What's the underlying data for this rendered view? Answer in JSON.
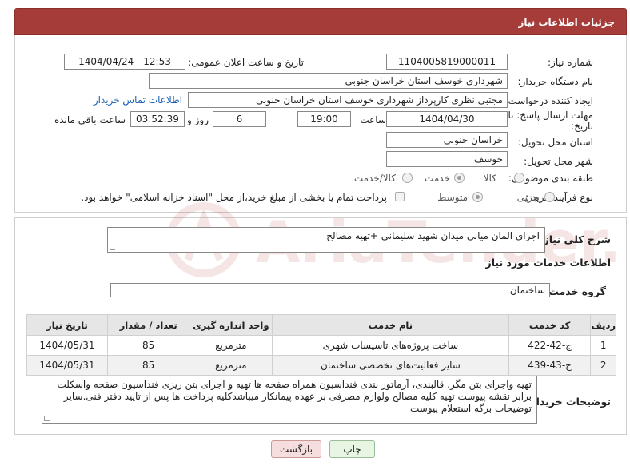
{
  "header": {
    "title": "جزئیات اطلاعات نیاز"
  },
  "form": {
    "need_number_label": "شماره نیاز:",
    "need_number": "1104005819000011",
    "announce_label": "تاریخ و ساعت اعلان عمومی:",
    "announce_value": "1404/04/24 - 12:53",
    "buyer_org_label": "نام دستگاه خریدار:",
    "buyer_org": "شهرداری خوسف استان خراسان جنوبی",
    "creator_label": "ایجاد کننده درخواست:",
    "creator": "مجتبی نظری کارپرداز شهرداری خوسف استان خراسان جنوبی",
    "contact_link": "اطلاعات تماس خریدار",
    "deadline_label_1": "مهلت ارسال پاسخ: تا",
    "deadline_label_2": "تاریخ:",
    "deadline_date": "1404/04/30",
    "time_label": "ساعت",
    "deadline_time": "19:00",
    "days_value": "6",
    "days_label": "روز و",
    "remaining_time": "03:52:39",
    "remaining_label": "ساعت باقی مانده",
    "province_label": "استان محل تحویل:",
    "province": "خراسان جنوبی",
    "city_label": "شهر محل تحویل:",
    "city": "خوسف",
    "category_label": "طبقه بندی موضوعی:",
    "category_options": [
      "کالا",
      "خدمت",
      "کالا/خدمت"
    ],
    "category_selected": "خدمت",
    "process_label": "نوع فرآیند خرید :",
    "process_options": [
      "جزیی",
      "متوسط"
    ],
    "process_selected": "جزیی",
    "payment_note": "پرداخت تمام یا بخشی از مبلغ خرید،از محل \"اسناد خزانه اسلامی\" خواهد بود."
  },
  "details": {
    "summary_label": "شرح کلی نیاز:",
    "summary": "اجرای المان میانی میدان شهید سلیمانی +تهیه مصالح",
    "services_heading": "اطلاعات خدمات مورد نیاز",
    "service_group_label": "گروه خدمت:",
    "service_group": "ساختمان"
  },
  "table": {
    "headers": [
      "ردیف",
      "کد خدمت",
      "نام خدمت",
      "واحد اندازه گیری",
      "تعداد / مقدار",
      "تاریخ نیاز"
    ],
    "rows": [
      [
        "1",
        "ج-42-422",
        "ساخت پروژه‌های تاسیسات شهری",
        "مترمربع",
        "85",
        "1404/05/31"
      ],
      [
        "2",
        "ج-43-439",
        "سایر فعالیت‌های تخصصی ساختمان",
        "مترمربع",
        "85",
        "1404/05/31"
      ]
    ]
  },
  "buyer_notes": {
    "label": "توضیحات خریدار:",
    "text": "تهیه واجرای بتن مگر، قالبندی، آرماتور بندی فنداسیون همراه صفحه ها تهیه و اجرای بتن ریزی فنداسیون صفحه واسکلت برابر نقشه پیوست تهیه کلیه مصالح ولوازم مصرفی بر عهده پیمانکار میباشدکلیه پرداخت ها پس از تایید دفتر فنی.سایر توضیحات برگه استعلام پیوست"
  },
  "buttons": {
    "back": "بازگشت",
    "print": "چاپ"
  },
  "colors": {
    "header_bg": "#a63c3a",
    "link": "#1a5fb4",
    "watermark": "#b03030"
  }
}
